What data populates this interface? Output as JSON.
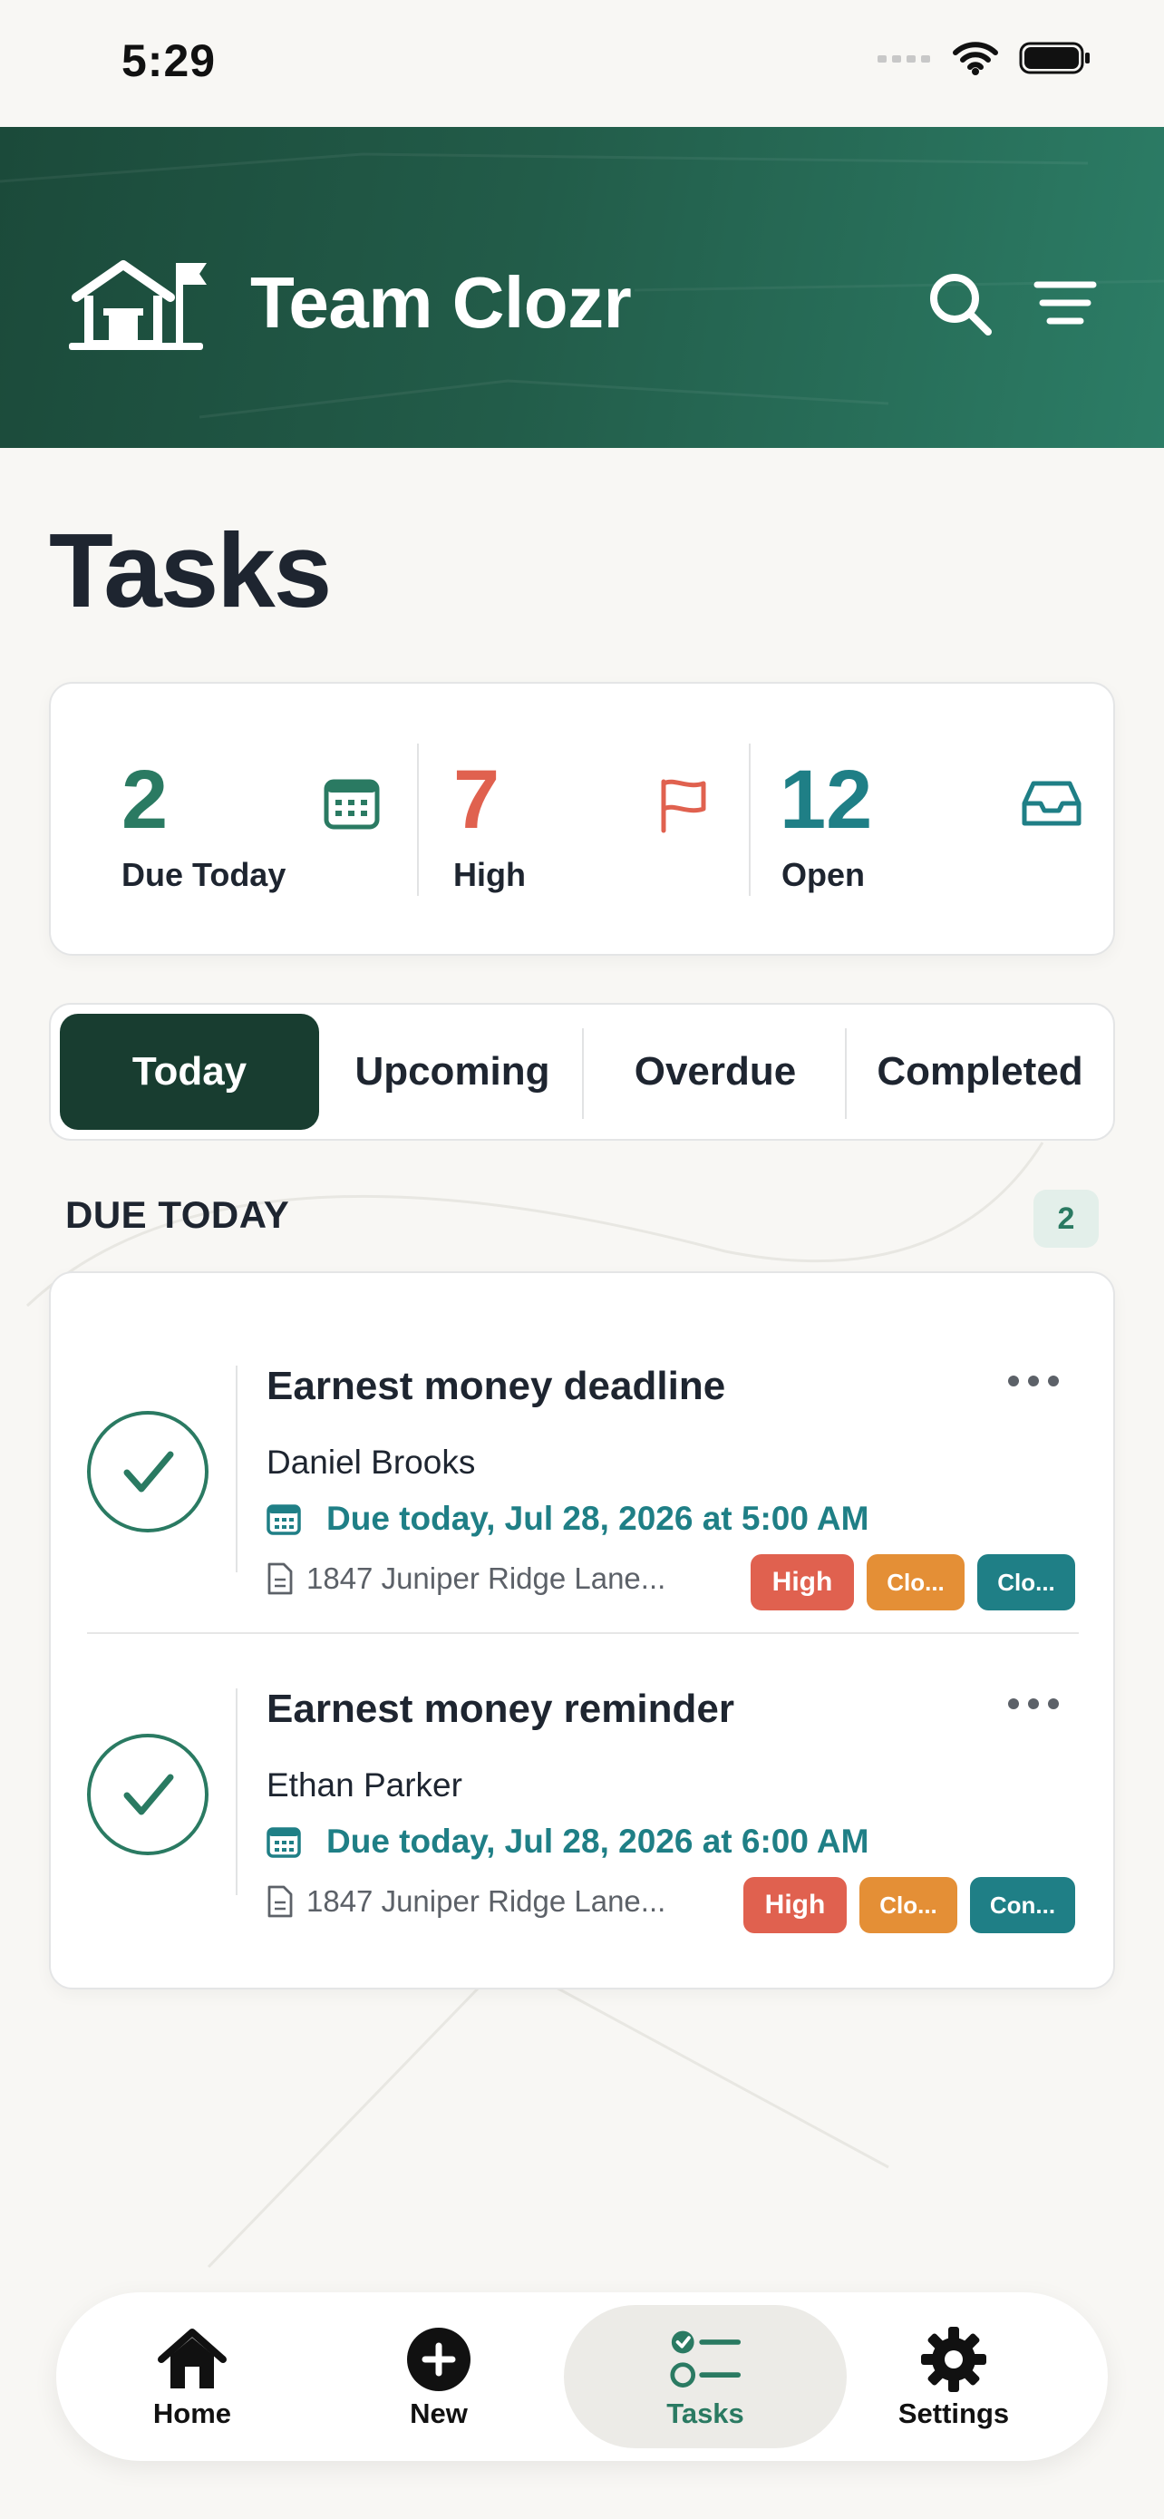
{
  "status_bar": {
    "time": "5:29"
  },
  "header": {
    "app_title": "Team Clozr"
  },
  "page": {
    "title": "Tasks"
  },
  "stats": [
    {
      "value": "2",
      "label": "Due Today",
      "color": "#2a7a62",
      "icon": "calendar-icon"
    },
    {
      "value": "7",
      "label": "High",
      "color": "#e0614f",
      "icon": "flag-icon"
    },
    {
      "value": "12",
      "label": "Open",
      "color": "#1f7f86",
      "icon": "inbox-icon"
    }
  ],
  "tabs": [
    {
      "label": "Today",
      "active": true
    },
    {
      "label": "Upcoming",
      "active": false
    },
    {
      "label": "Overdue",
      "active": false
    },
    {
      "label": "Completed",
      "active": false
    }
  ],
  "section": {
    "label": "DUE TODAY",
    "count": "2"
  },
  "tasks": [
    {
      "title": "Earnest money deadline",
      "person": "Daniel Brooks",
      "due": "Due today, Jul 28, 2026 at 5:00 AM",
      "address": "1847 Juniper Ridge Lane...",
      "badges": [
        "High",
        "Clo...",
        "Clo..."
      ]
    },
    {
      "title": "Earnest money reminder",
      "person": "Ethan Parker",
      "due": "Due today, Jul 28, 2026 at 6:00 AM",
      "address": "1847 Juniper Ridge Lane...",
      "badges": [
        "High",
        "Clo...",
        "Con..."
      ]
    }
  ],
  "nav": [
    {
      "label": "Home",
      "icon": "home-icon"
    },
    {
      "label": "New",
      "icon": "plus-circle-icon"
    },
    {
      "label": "Tasks",
      "icon": "tasks-list-icon",
      "active": true
    },
    {
      "label": "Settings",
      "icon": "gear-icon"
    }
  ],
  "colors": {
    "brand_dark": "#183d30",
    "accent_green": "#2a7a62",
    "accent_teal": "#1f7f86",
    "high": "#e0614f",
    "orange": "#e48f36"
  }
}
